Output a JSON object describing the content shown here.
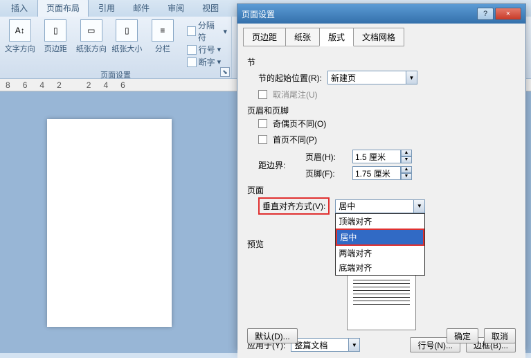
{
  "ribbon": {
    "tabs": {
      "insert": "插入",
      "pageLayout": "页面布局",
      "references": "引用",
      "mailings": "邮件",
      "review": "审阅",
      "view": "视图"
    },
    "activeTab": "页面布局",
    "buttons": {
      "textDirection": "文字方向",
      "margins": "页边距",
      "orientation": "纸张方向",
      "size": "纸张大小",
      "columns": "分栏"
    },
    "minis": {
      "breaks": "分隔符",
      "lineNumbers": "行号",
      "hyphenation": "断字"
    },
    "groupTitle": "页面设置"
  },
  "ruler": {
    "marks": [
      "8",
      "6",
      "4",
      "2",
      "",
      "2",
      "4",
      "6"
    ]
  },
  "dialog": {
    "title": "页面设置",
    "titleCtl": {
      "help": "?",
      "close": "×"
    },
    "tabs": {
      "margins": "页边距",
      "paper": "纸张",
      "layout": "版式",
      "docGrid": "文档网格"
    },
    "section": {
      "label": "节",
      "startLabel": "节的起始位置(R):",
      "startValue": "新建页",
      "suppressEndnotes": "取消尾注(U)"
    },
    "headersFooters": {
      "label": "页眉和页脚",
      "diffOddEven": "奇偶页不同(O)",
      "diffFirst": "首页不同(P)",
      "fromEdgeLabel": "距边界:",
      "headerLabel": "页眉(H):",
      "headerValue": "1.5 厘米",
      "footerLabel": "页脚(F):",
      "footerValue": "1.75 厘米"
    },
    "page": {
      "label": "页面",
      "vAlignLabel": "垂直对齐方式(V):",
      "vAlignValue": "居中",
      "options": {
        "top": "顶端对齐",
        "center": "居中",
        "justify": "两端对齐",
        "bottom": "底端对齐"
      }
    },
    "preview": {
      "label": "预览"
    },
    "applyToLabel": "应用于(Y):",
    "applyToValue": "整篇文档",
    "buttons": {
      "lineNumbers": "行号(N)...",
      "borders": "边框(B)...",
      "default": "默认(D)...",
      "ok": "确定",
      "cancel": "取消"
    }
  }
}
